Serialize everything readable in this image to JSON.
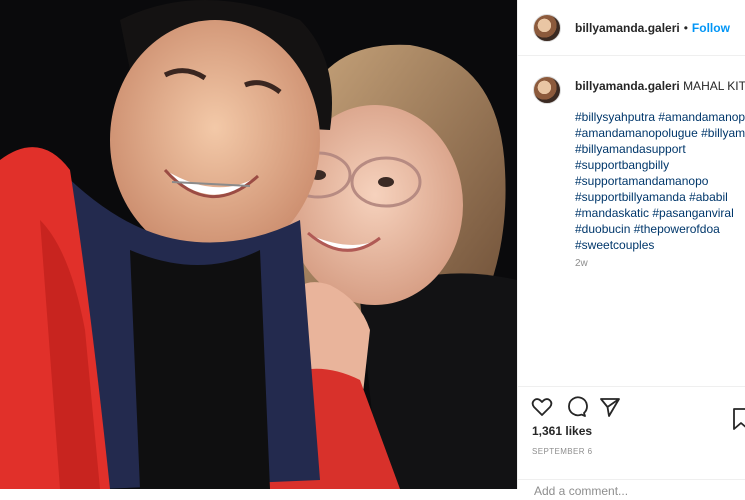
{
  "post": {
    "username": "billyamanda.galeri",
    "separator": "•",
    "follow_label": "Follow"
  },
  "caption": {
    "username": "billyamanda.galeri",
    "text": "MAHAL KITA",
    "tags": [
      "#billysyahputra #amandamanop",
      "#amandamanopolugue #billyam",
      "#billyamandasupport",
      "#supportbangbilly",
      "#supportamandamanopo",
      "#supportbillyamanda #ababil",
      "#mandaskatic #pasanganviral",
      "#duobucin #thepowerofdoa",
      "#sweetcouples"
    ],
    "time": "2w"
  },
  "actions": {
    "icons": [
      "heart-icon",
      "comment-icon",
      "share-icon",
      "bookmark-icon"
    ],
    "likes": "1,361 likes",
    "date": "SEPTEMBER 6",
    "add_comment_placeholder": "Add a comment..."
  },
  "colors": {
    "accent": "#0095f6",
    "link": "#00376b",
    "muted": "#8e8e8e",
    "border": "#efefef"
  }
}
